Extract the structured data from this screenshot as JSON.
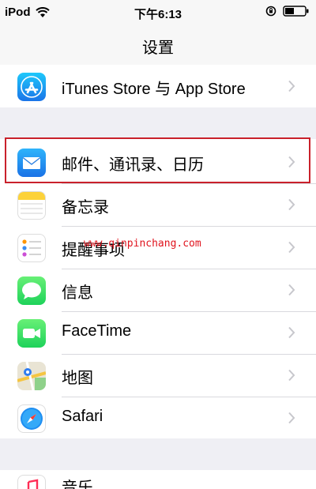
{
  "status_bar": {
    "carrier": "iPod",
    "time": "下午6:13"
  },
  "nav": {
    "title": "设置"
  },
  "rows": [
    {
      "label": "iTunes Store 与 App Store",
      "icon": "app-store-icon"
    },
    {
      "label": "邮件、通讯录、日历",
      "icon": "mail-icon"
    },
    {
      "label": "备忘录",
      "icon": "notes-icon"
    },
    {
      "label": "提醒事项",
      "icon": "reminders-icon"
    },
    {
      "label": "信息",
      "icon": "messages-icon"
    },
    {
      "label": "FaceTime",
      "icon": "facetime-icon"
    },
    {
      "label": "地图",
      "icon": "maps-icon"
    },
    {
      "label": "Safari",
      "icon": "safari-icon"
    }
  ],
  "partial_row": {
    "label": "音乐",
    "icon": "music-icon"
  },
  "watermark": "www.qinpinchang.com",
  "colors": {
    "highlight": "#c9212b",
    "watermark": "#e0141e",
    "background": "#efeff4"
  }
}
